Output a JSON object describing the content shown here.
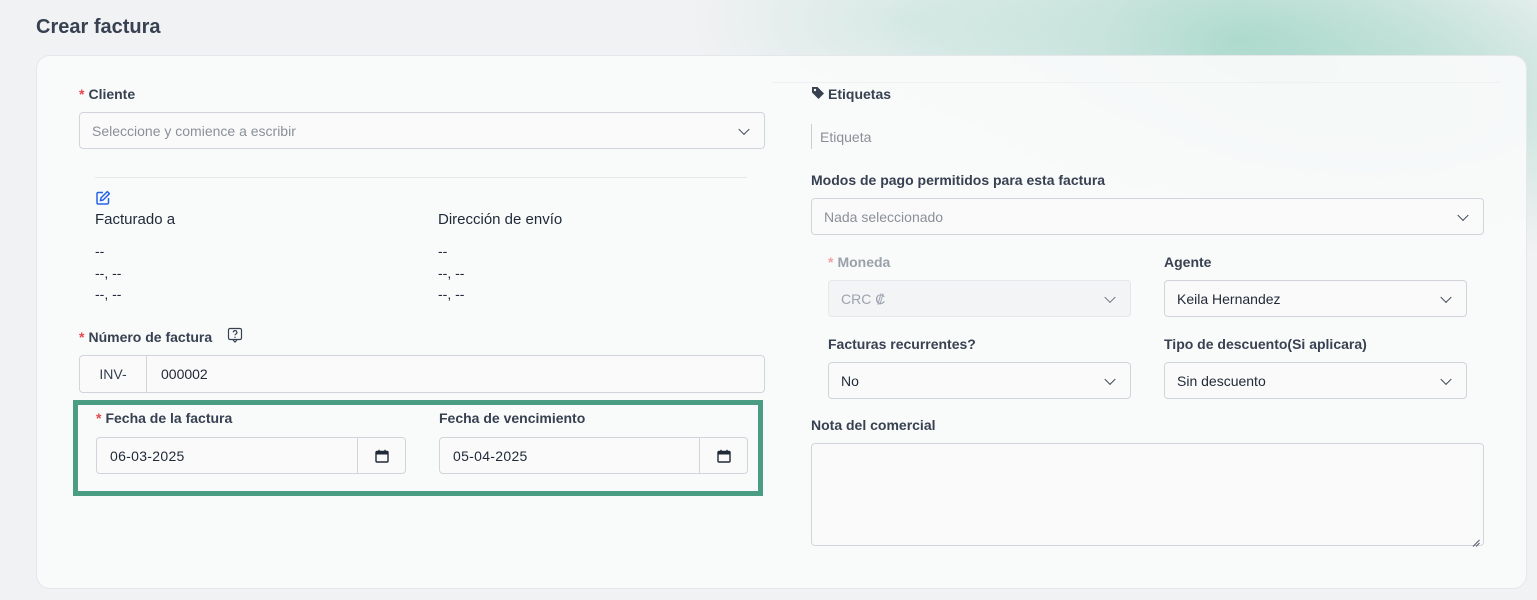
{
  "page": {
    "title": "Crear factura"
  },
  "colors": {
    "accent": "#4a9c82",
    "required": "#e5484d",
    "edit_icon": "#2563eb"
  },
  "client": {
    "label": "Cliente",
    "required_mark": "*",
    "placeholder": "Seleccione y comience a escribir",
    "icon": "chevron-down-icon"
  },
  "addresses": {
    "edit_icon": "edit-icon",
    "billing": {
      "title": "Facturado a",
      "line1": "--",
      "line2": "--, --",
      "line3": "--, --"
    },
    "shipping": {
      "title": "Dirección de envío",
      "line1": "--",
      "line2": "--, --",
      "line3": "--, --"
    }
  },
  "invoice_number": {
    "label": "Número de factura",
    "required_mark": "*",
    "help_icon": "help-icon",
    "prefix": "INV-",
    "value": "000002"
  },
  "invoice_date": {
    "label": "Fecha de la factura",
    "required_mark": "*",
    "value": "06-03-2025",
    "icon": "calendar-icon"
  },
  "due_date": {
    "label": "Fecha de vencimiento",
    "value": "05-04-2025",
    "icon": "calendar-icon"
  },
  "tags": {
    "label": "Etiquetas",
    "icon": "tag-icon",
    "placeholder": "Etiqueta"
  },
  "payment_modes": {
    "label": "Modos de pago permitidos para esta factura",
    "placeholder": "Nada seleccionado"
  },
  "currency": {
    "label": "Moneda",
    "required_mark": "*",
    "value": "CRC ₡",
    "disabled": true
  },
  "agent": {
    "label": "Agente",
    "value": "Keila Hernandez"
  },
  "recurring": {
    "label": "Facturas recurrentes?",
    "value": "No"
  },
  "discount_type": {
    "label": "Tipo de descuento(Si aplicara)",
    "value": "Sin descuento"
  },
  "admin_note": {
    "label": "Nota del comercial",
    "value": ""
  }
}
